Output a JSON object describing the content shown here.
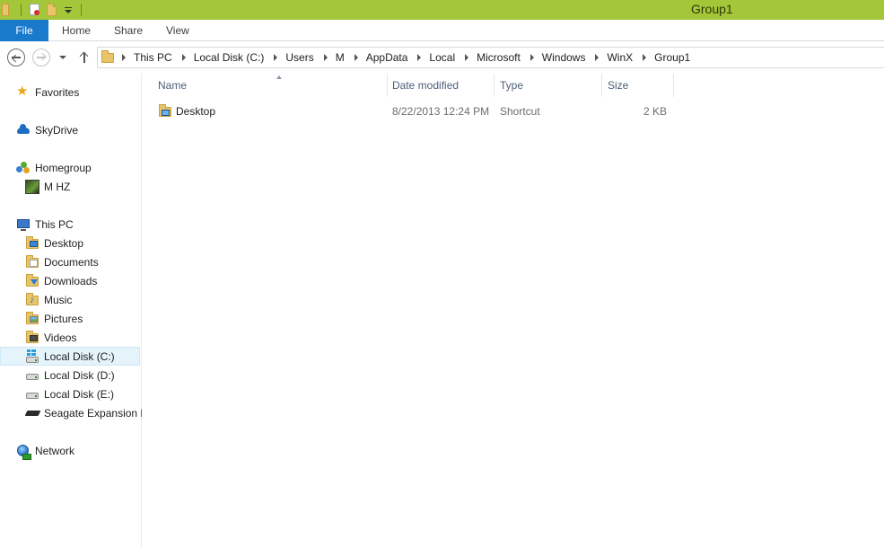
{
  "window": {
    "title": "Group1"
  },
  "ribbon": {
    "file_tab": "File",
    "tabs": [
      "Home",
      "Share",
      "View"
    ]
  },
  "address": {
    "breadcrumbs": [
      "This PC",
      "Local Disk (C:)",
      "Users",
      "M",
      "AppData",
      "Local",
      "Microsoft",
      "Windows",
      "WinX",
      "Group1"
    ]
  },
  "navpane": {
    "favorites": "Favorites",
    "skydrive": "SkyDrive",
    "homegroup": "Homegroup",
    "homegroup_user": "M HZ",
    "this_pc": "This PC",
    "this_pc_items": [
      "Desktop",
      "Documents",
      "Downloads",
      "Music",
      "Pictures",
      "Videos",
      "Local Disk (C:)",
      "Local Disk (D:)",
      "Local Disk (E:)",
      "Seagate Expansion D"
    ],
    "network": "Network",
    "selected": "Local Disk (C:)"
  },
  "columns": {
    "name": "Name",
    "date_modified": "Date modified",
    "type": "Type",
    "size": "Size"
  },
  "files": [
    {
      "name": "Desktop",
      "date_modified": "8/22/2013 12:24 PM",
      "type": "Shortcut",
      "size": "2 KB"
    }
  ],
  "colors": {
    "titlebar": "#a4c639",
    "file_tab": "#1979ca",
    "selection": "#e5f3fb"
  }
}
